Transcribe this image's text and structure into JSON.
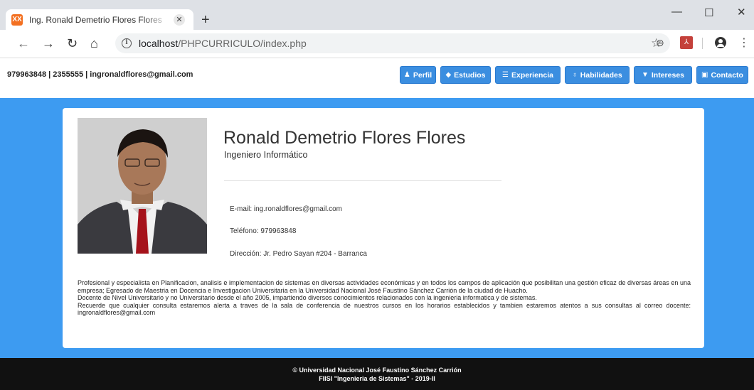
{
  "browser": {
    "tab_title": "Ing. Ronald Demetrio Flores Flores",
    "favicon_label": "XX",
    "url_host": "localhost",
    "url_path": "/PHPCURRICULO/index.php"
  },
  "header": {
    "contact_line": "979963848 | 2355555 | ingronaldflores@gmail.com"
  },
  "nav": [
    {
      "label": "Perfil",
      "icon": "person-icon"
    },
    {
      "label": "Estudios",
      "icon": "graduation-cap-icon"
    },
    {
      "label": "Experiencia",
      "icon": "database-icon"
    },
    {
      "label": "Habilidades",
      "icon": "thumbs-up-icon"
    },
    {
      "label": "Intereses",
      "icon": "filter-icon"
    },
    {
      "label": "Contacto",
      "icon": "contact-card-icon"
    }
  ],
  "profile": {
    "name": "Ronald Demetrio Flores Flores",
    "role": "Ingeniero Informático",
    "email": "E-mail: ing.ronaldflores@gmail.com",
    "phone": "Teléfono: 979963848",
    "address": "Dirección: Jr. Pedro Sayan #204 - Barranca",
    "bio": [
      "Profesional y especialista en Planificacion, analisis e implementacion de sistemas en diversas actividades económicas y en todos los campos de aplicación que posibilitan una gestión eficaz de diversas áreas en una empresa; Egresado de Maestria en Docencia e Investigacion Universitaria en la Universidad Nacional José Faustino Sánchez Carrión de la ciudad de Huacho.",
      "Docente de Nivel Universitario y no Universitario desde el año 2005, impartiendo diversos conocimientos relacionados con la ingenieria informatica y de sistemas.",
      "Recuerde que cualquier consulta estaremos alerta a traves de la sala de conferencia de nuestros cursos en los horarios establecidos y tambien estaremos atentos a sus consultas al correo docente: ingronaldflores@gmail.com"
    ]
  },
  "footer": {
    "line1": "© Universidad Nacional José Faustino Sánchez Carrión",
    "line2": "FIISI \"Ingenieria de Sistemas\" - 2019-II"
  },
  "colors": {
    "hero_bg": "#3d9bf1",
    "nav_button": "#3b8ee0",
    "footer_bg": "#111111"
  }
}
